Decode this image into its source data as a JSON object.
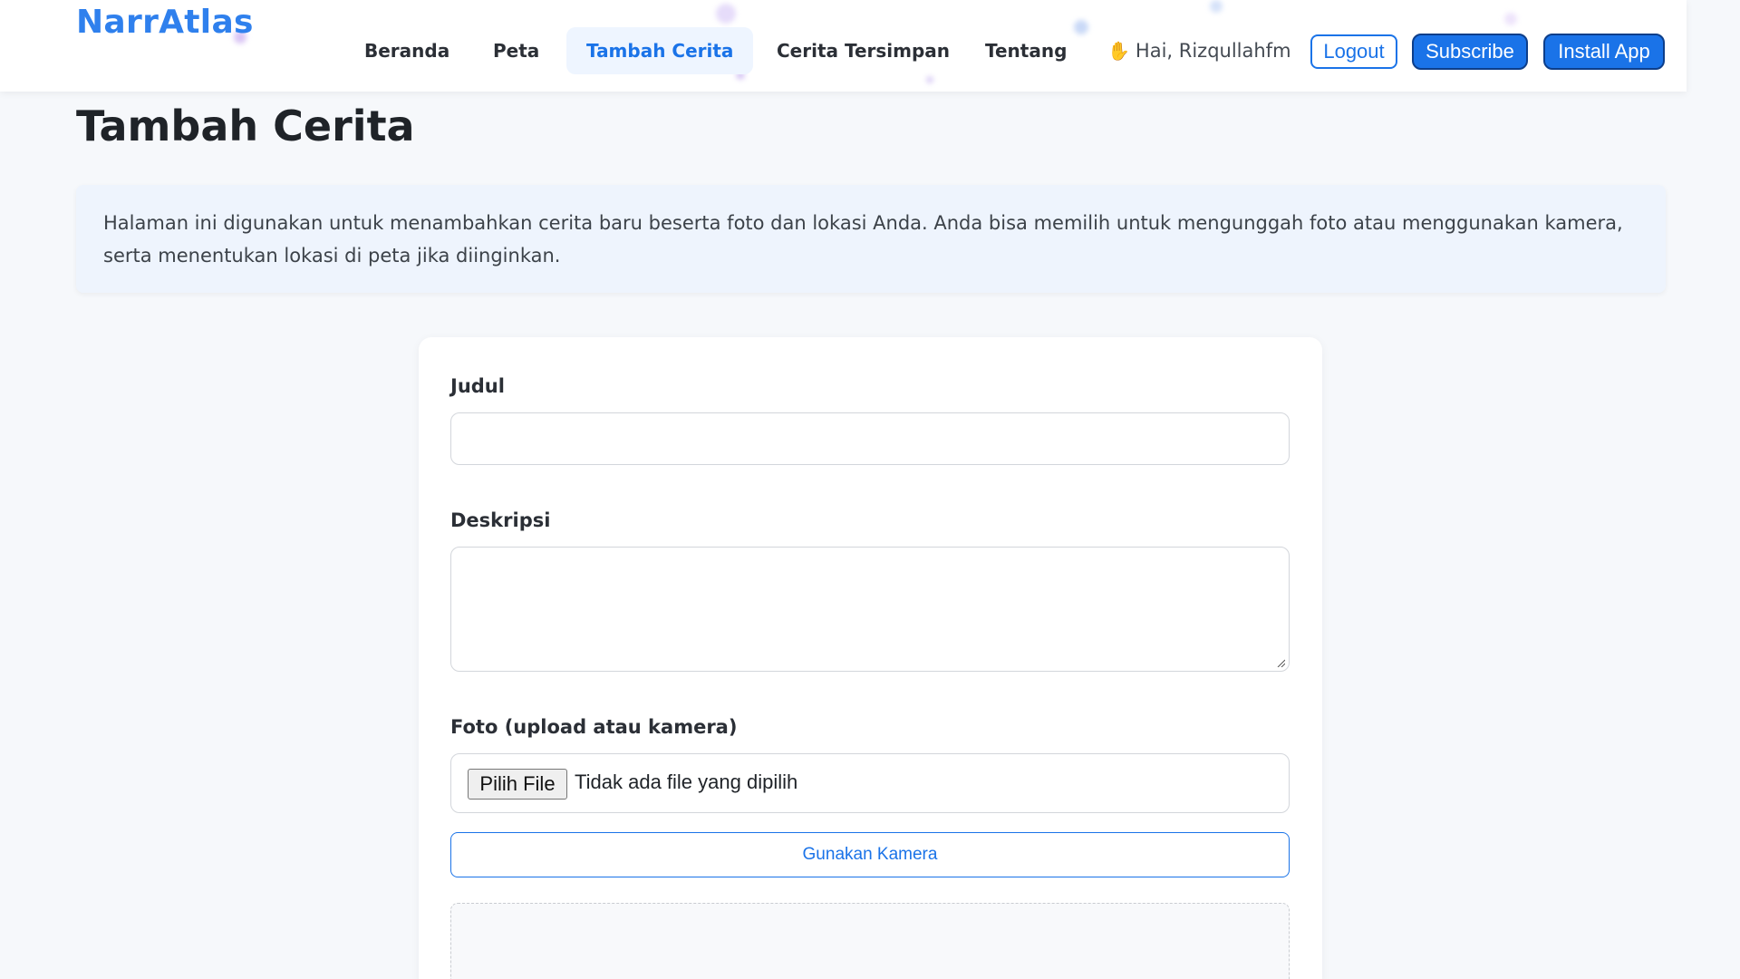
{
  "header": {
    "brand": "NarrAtlas",
    "nav": [
      {
        "label": "Beranda",
        "active": false
      },
      {
        "label": "Peta",
        "active": false
      },
      {
        "label": "Tambah Cerita",
        "active": true
      },
      {
        "label": "Cerita Tersimpan",
        "active": false
      },
      {
        "label": "Tentang",
        "active": false
      }
    ],
    "greeting_icon": "waving-hand-icon",
    "greeting": "Hai, Rizqullahfm",
    "logout_label": "Logout",
    "subscribe_label": "Subscribe",
    "install_label": "Install App"
  },
  "main": {
    "title": "Tambah Cerita",
    "info": "Halaman ini digunakan untuk menambahkan cerita baru beserta foto dan lokasi Anda. Anda bisa memilih untuk mengunggah foto atau menggunakan kamera, serta menentukan lokasi di peta jika diinginkan."
  },
  "form": {
    "title_label": "Judul",
    "title_value": "",
    "description_label": "Deskripsi",
    "description_value": "",
    "photo_label": "Foto (upload atau kamera)",
    "file_button": "Pilih File",
    "file_status": "Tidak ada file yang dipilih",
    "camera_button": "Gunakan Kamera"
  },
  "colors": {
    "accent": "#1a73e8",
    "brand": "#2f80ed",
    "background": "#f6f8fb",
    "info_box": "#eef4fd"
  }
}
